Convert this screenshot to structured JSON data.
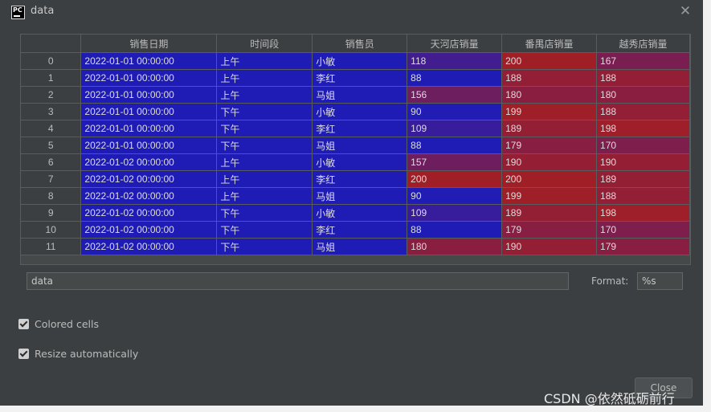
{
  "window": {
    "title": "data",
    "app_icon_text": "PC",
    "close_symbol": "✕"
  },
  "table": {
    "columns": [
      "销售日期",
      "时间段",
      "销售员",
      "天河店销量",
      "番禺店销量",
      "越秀店销量"
    ],
    "rows": [
      {
        "index": "0",
        "date": "2022-01-01 00:00:00",
        "period": "上午",
        "seller": "小敏",
        "tianhe": "118",
        "panyu": "200",
        "yuexiu": "167"
      },
      {
        "index": "1",
        "date": "2022-01-01 00:00:00",
        "period": "上午",
        "seller": "李红",
        "tianhe": "88",
        "panyu": "188",
        "yuexiu": "188"
      },
      {
        "index": "2",
        "date": "2022-01-01 00:00:00",
        "period": "上午",
        "seller": "马姐",
        "tianhe": "156",
        "panyu": "180",
        "yuexiu": "180"
      },
      {
        "index": "3",
        "date": "2022-01-01 00:00:00",
        "period": "下午",
        "seller": "小敏",
        "tianhe": "90",
        "panyu": "199",
        "yuexiu": "188"
      },
      {
        "index": "4",
        "date": "2022-01-01 00:00:00",
        "period": "下午",
        "seller": "李红",
        "tianhe": "109",
        "panyu": "189",
        "yuexiu": "198"
      },
      {
        "index": "5",
        "date": "2022-01-01 00:00:00",
        "period": "下午",
        "seller": "马姐",
        "tianhe": "88",
        "panyu": "179",
        "yuexiu": "170"
      },
      {
        "index": "6",
        "date": "2022-01-02 00:00:00",
        "period": "上午",
        "seller": "小敏",
        "tianhe": "157",
        "panyu": "190",
        "yuexiu": "190"
      },
      {
        "index": "7",
        "date": "2022-01-02 00:00:00",
        "period": "上午",
        "seller": "李红",
        "tianhe": "200",
        "panyu": "200",
        "yuexiu": "189"
      },
      {
        "index": "8",
        "date": "2022-01-02 00:00:00",
        "period": "上午",
        "seller": "马姐",
        "tianhe": "90",
        "panyu": "199",
        "yuexiu": "188"
      },
      {
        "index": "9",
        "date": "2022-01-02 00:00:00",
        "period": "下午",
        "seller": "小敏",
        "tianhe": "109",
        "panyu": "189",
        "yuexiu": "198"
      },
      {
        "index": "10",
        "date": "2022-01-02 00:00:00",
        "period": "下午",
        "seller": "李红",
        "tianhe": "88",
        "panyu": "179",
        "yuexiu": "170"
      },
      {
        "index": "11",
        "date": "2022-01-02 00:00:00",
        "period": "下午",
        "seller": "马姐",
        "tianhe": "180",
        "panyu": "190",
        "yuexiu": "179"
      }
    ]
  },
  "expression_field": {
    "value": "data"
  },
  "format": {
    "label": "Format:",
    "value": "%s"
  },
  "options": {
    "colored_cells": {
      "label": "Colored cells",
      "checked": true
    },
    "resize_automatically": {
      "label": "Resize automatically",
      "checked": true
    }
  },
  "close_button": {
    "label": "Close"
  },
  "watermark": {
    "text": "CSDN @依然砥砺前行"
  },
  "colors": {
    "background": "#3c3f41",
    "blue_low": "#1f1cb6",
    "red_high": "#a01f27"
  }
}
